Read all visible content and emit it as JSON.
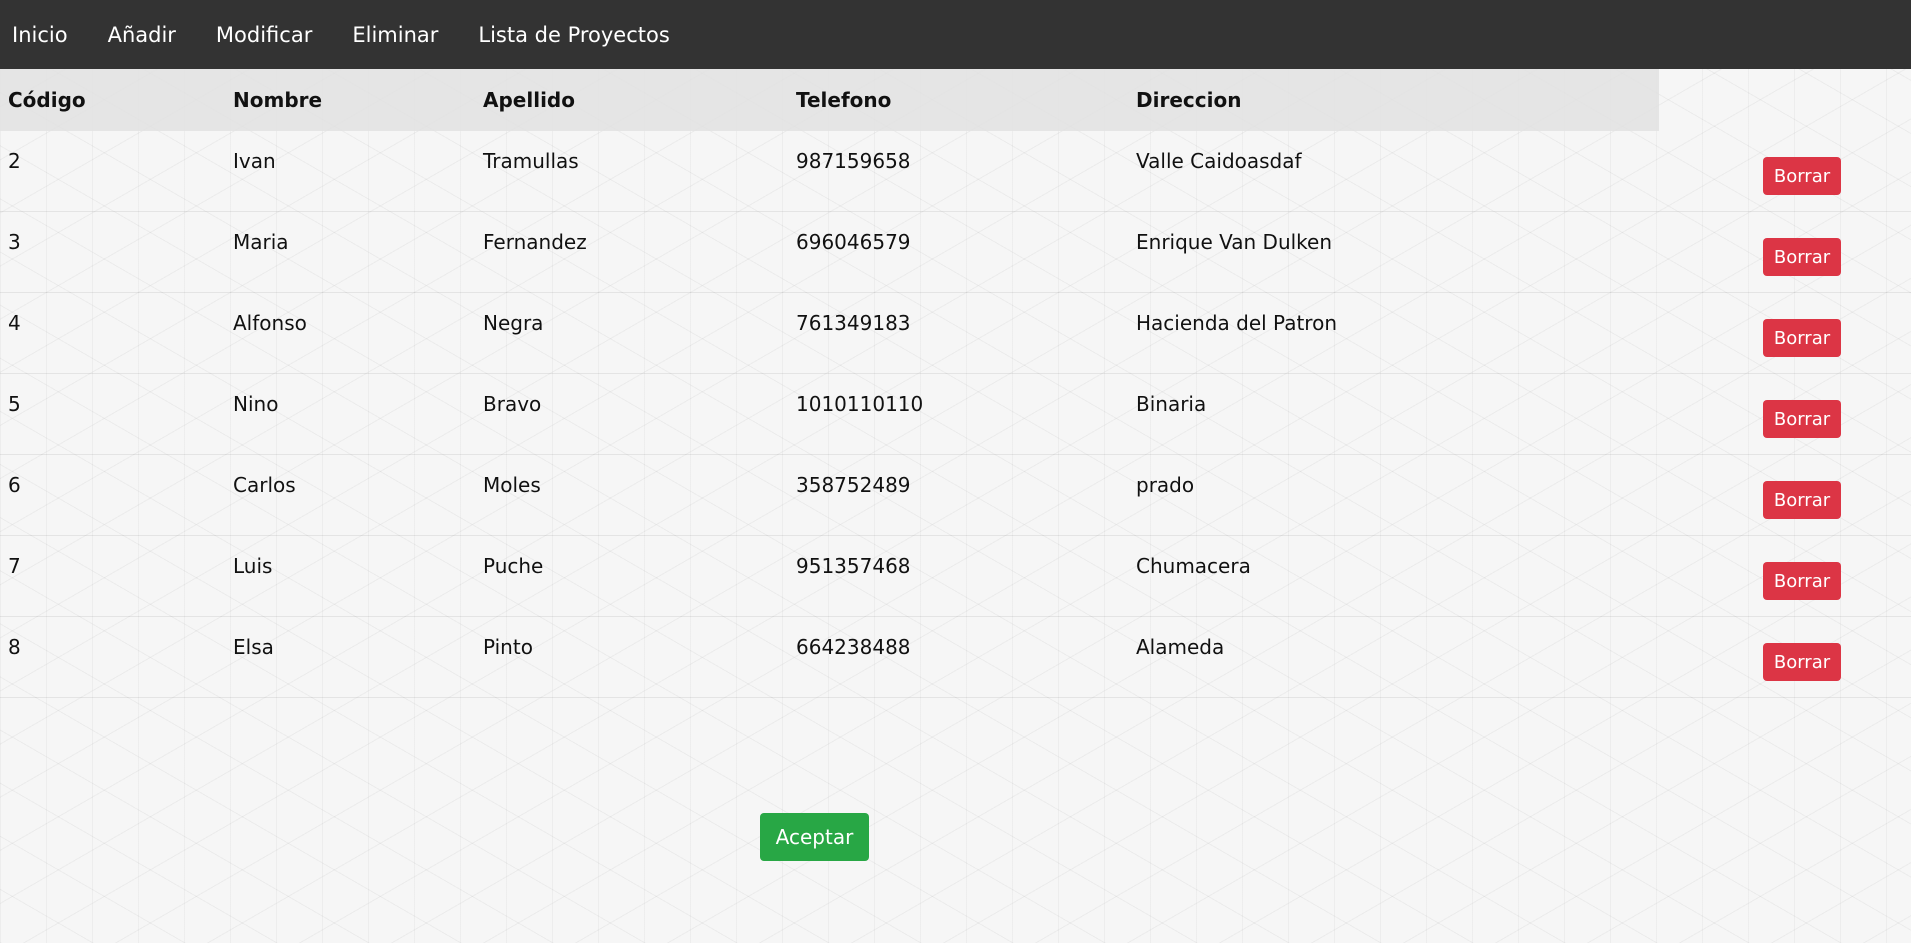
{
  "nav": {
    "items": [
      "Inicio",
      "Añadir",
      "Modificar",
      "Eliminar",
      "Lista de Proyectos"
    ]
  },
  "table": {
    "headers": [
      "Código",
      "Nombre",
      "Apellido",
      "Telefono",
      "Direccion"
    ],
    "delete_label": "Borrar",
    "rows": [
      [
        "2",
        "Ivan",
        "Tramullas",
        "987159658",
        "Valle Caidoasdaf"
      ],
      [
        "3",
        "Maria",
        "Fernandez",
        "696046579",
        "Enrique Van Dulken"
      ],
      [
        "4",
        "Alfonso",
        "Negra",
        "761349183",
        "Hacienda del Patron"
      ],
      [
        "5",
        "Nino",
        "Bravo",
        "1010110110",
        "Binaria"
      ],
      [
        "6",
        "Carlos",
        "Moles",
        "358752489",
        "prado"
      ],
      [
        "7",
        "Luis",
        "Puche",
        "951357468",
        "Chumacera"
      ],
      [
        "8",
        "Elsa",
        "Pinto",
        "664238488",
        "Alameda"
      ]
    ]
  },
  "accept_label": "Aceptar",
  "colors": {
    "navbar_bg": "#333333",
    "delete_button": "#dc3545",
    "accept_button": "#28a745"
  }
}
